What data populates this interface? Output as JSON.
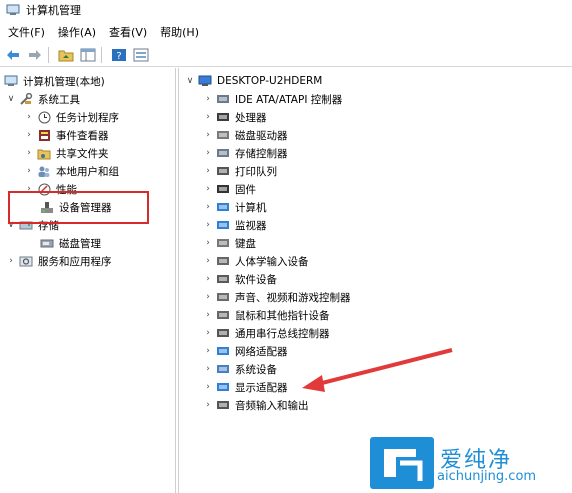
{
  "window": {
    "title": "计算机管理"
  },
  "menu": [
    {
      "label": "文件(F)"
    },
    {
      "label": "操作(A)"
    },
    {
      "label": "查看(V)"
    },
    {
      "label": "帮助(H)"
    }
  ],
  "left_tree": [
    {
      "label": "计算机管理(本地)",
      "expanded": true,
      "icon": "computer-mgmt-icon"
    },
    {
      "label": "系统工具",
      "expanded": true,
      "icon": "tools-icon"
    },
    {
      "label": "任务计划程序",
      "icon": "clock-icon"
    },
    {
      "label": "事件查看器",
      "icon": "event-viewer-icon"
    },
    {
      "label": "共享文件夹",
      "icon": "shared-folder-icon"
    },
    {
      "label": "本地用户和组",
      "icon": "users-icon"
    },
    {
      "label": "性能",
      "icon": "performance-icon"
    },
    {
      "label": "设备管理器",
      "icon": "device-manager-icon",
      "selected": true
    },
    {
      "label": "存储",
      "expanded": true,
      "icon": "storage-icon"
    },
    {
      "label": "磁盘管理",
      "icon": "disk-mgmt-icon"
    },
    {
      "label": "服务和应用程序",
      "icon": "services-icon"
    }
  ],
  "device_tree": {
    "root": "DESKTOP-U2HDERM",
    "items": [
      {
        "label": "IDE ATA/ATAPI 控制器",
        "icon": "ide-icon"
      },
      {
        "label": "处理器",
        "icon": "cpu-icon"
      },
      {
        "label": "磁盘驱动器",
        "icon": "disk-icon"
      },
      {
        "label": "存储控制器",
        "icon": "storage-controller-icon"
      },
      {
        "label": "打印队列",
        "icon": "printer-icon"
      },
      {
        "label": "固件",
        "icon": "firmware-icon"
      },
      {
        "label": "计算机",
        "icon": "computer-icon"
      },
      {
        "label": "监视器",
        "icon": "monitor-icon"
      },
      {
        "label": "键盘",
        "icon": "keyboard-icon"
      },
      {
        "label": "人体学输入设备",
        "icon": "hid-icon"
      },
      {
        "label": "软件设备",
        "icon": "software-device-icon"
      },
      {
        "label": "声音、视频和游戏控制器",
        "icon": "sound-icon"
      },
      {
        "label": "鼠标和其他指针设备",
        "icon": "mouse-icon"
      },
      {
        "label": "通用串行总线控制器",
        "icon": "usb-icon"
      },
      {
        "label": "网络适配器",
        "icon": "network-icon"
      },
      {
        "label": "系统设备",
        "icon": "system-device-icon"
      },
      {
        "label": "显示适配器",
        "icon": "display-adapter-icon"
      },
      {
        "label": "音频输入和输出",
        "icon": "audio-io-icon"
      }
    ]
  },
  "watermark": {
    "brand": "爱纯净",
    "url": "aichunjing.com"
  },
  "colors": {
    "highlight": "#d92a2a",
    "arrow": "#e23a3a",
    "watermark": "#1e8fd6"
  }
}
